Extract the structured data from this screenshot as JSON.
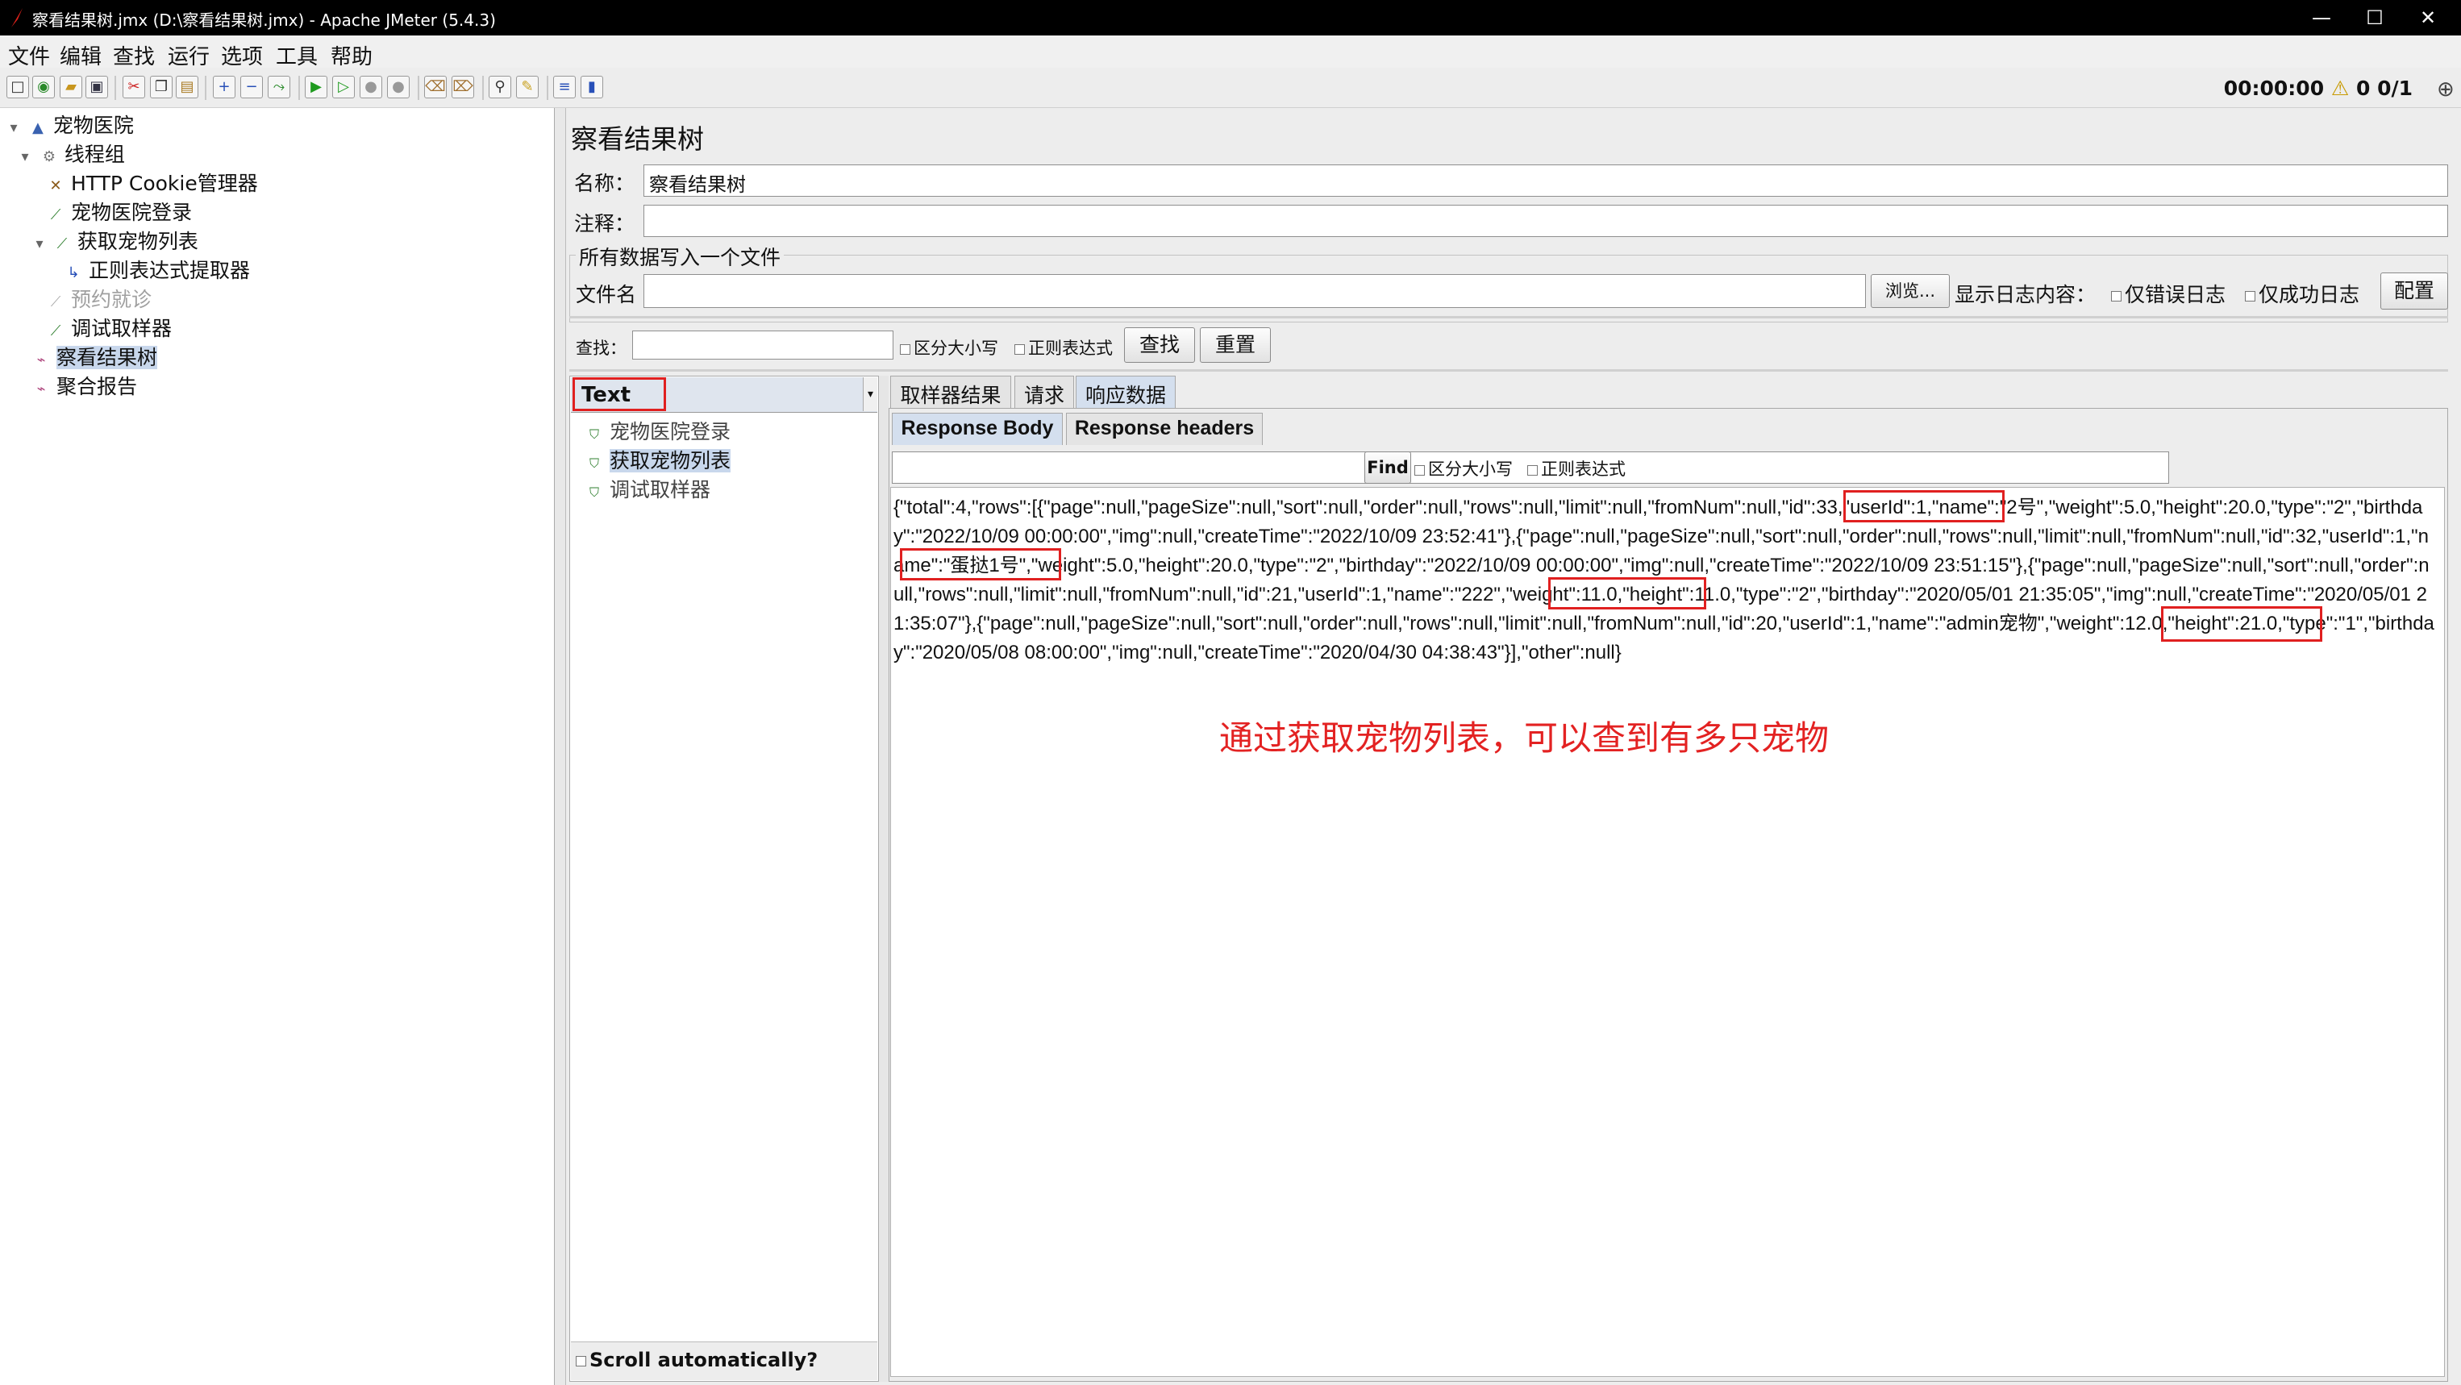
{
  "window": {
    "title": "察看结果树.jmx (D:\\察看结果树.jmx) - Apache JMeter (5.4.3)",
    "controls": [
      "—",
      "☐",
      "✕"
    ]
  },
  "menubar": [
    "文件",
    "编辑",
    "查找",
    "运行",
    "选项",
    "工具",
    "帮助"
  ],
  "toolbar": {
    "status": "00:00:00",
    "warning_icon": "⚠",
    "warning_count": "0",
    "threads": "0/1"
  },
  "tree": [
    {
      "label": "宠物医院",
      "icon": "test-plan-icon"
    },
    {
      "label": "线程组",
      "icon": "thread-group-icon"
    },
    {
      "label": "HTTP Cookie管理器",
      "icon": "cookie-manager-icon"
    },
    {
      "label": "宠物医院登录",
      "icon": "sampler-icon"
    },
    {
      "label": "获取宠物列表",
      "icon": "sampler-icon"
    },
    {
      "label": "正则表达式提取器",
      "icon": "extractor-icon"
    },
    {
      "label": "预约就诊",
      "icon": "sampler-icon"
    },
    {
      "label": "调试取样器",
      "icon": "sampler-icon"
    },
    {
      "label": "察看结果树",
      "icon": "listener-icon"
    },
    {
      "label": "聚合报告",
      "icon": "listener-icon"
    }
  ],
  "panel": {
    "title": "察看结果树",
    "name_label": "名称：",
    "name_value": "察看结果树",
    "comment_label": "注释：",
    "comment_value": "",
    "file_section_title": "所有数据写入一个文件",
    "filename_label": "文件名",
    "filename_value": "",
    "browse_button": "浏览...",
    "log_label": "显示日志内容：",
    "errors_only": "仅错误日志",
    "success_only": "仅成功日志",
    "configure_button": "配置"
  },
  "search": {
    "label": "查找：",
    "value": "",
    "case_sensitive": "区分大小写",
    "regex": "正则表达式",
    "find_button": "查找",
    "reset_button": "重置"
  },
  "results": {
    "renderer": "Text",
    "samples": [
      "宠物医院登录",
      "获取宠物列表",
      "调试取样器"
    ],
    "scroll_auto": "Scroll automatically?",
    "tabs": [
      "取样器结果",
      "请求",
      "响应数据"
    ],
    "subtabs": [
      "Response Body",
      "Response headers"
    ],
    "find_button": "Find",
    "find_case": "区分大小写",
    "find_regex": "正则表达式",
    "body_text": "{\"total\":4,\"rows\":[{\"page\":null,\"pageSize\":null,\"sort\":null,\"order\":null,\"rows\":null,\"limit\":null,\"fromNum\":null,\"id\":33,\"userId\":1,\"name\":\"2号\",\"weight\":5.0,\"height\":20.0,\"type\":\"2\",\"birthday\":\"2022/10/09 00:00:00\",\"img\":null,\"createTime\":\"2022/10/09 23:52:41\"},{\"page\":null,\"pageSize\":null,\"sort\":null,\"order\":null,\"rows\":null,\"limit\":null,\"fromNum\":null,\"id\":32,\"userId\":1,\"name\":\"蛋挞1号\",\"weight\":5.0,\"height\":20.0,\"type\":\"2\",\"birthday\":\"2022/10/09 00:00:00\",\"img\":null,\"createTime\":\"2022/10/09 23:51:15\"},{\"page\":null,\"pageSize\":null,\"sort\":null,\"order\":null,\"rows\":null,\"limit\":null,\"fromNum\":null,\"id\":21,\"userId\":1,\"name\":\"222\",\"weight\":11.0,\"height\":11.0,\"type\":\"2\",\"birthday\":\"2020/05/01 21:35:05\",\"img\":null,\"createTime\":\"2020/05/01 21:35:07\"},{\"page\":null,\"pageSize\":null,\"sort\":null,\"order\":null,\"rows\":null,\"limit\":null,\"fromNum\":null,\"id\":20,\"userId\":1,\"name\":\"admin宠物\",\"weight\":12.0,\"height\":21.0,\"type\":\"1\",\"birthday\":\"2020/05/08 08:00:00\",\"img\":null,\"createTime\":\"2020/04/30 04:38:43\"}],\"other\":null}",
    "annotation": "通过获取宠物列表，可以查到有多只宠物"
  },
  "colors": {
    "annotation": "#e32222",
    "selection": "#c8d7ec"
  }
}
